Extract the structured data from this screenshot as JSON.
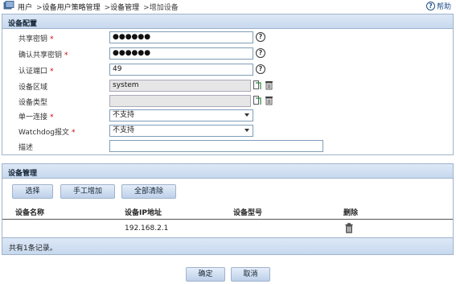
{
  "breadcrumb": {
    "items": [
      "用户",
      "设备用户策略管理",
      "设备管理",
      "增加设备"
    ],
    "separator": ">"
  },
  "help": {
    "label": "帮助"
  },
  "config_panel": {
    "title": "设备配置",
    "fields": {
      "shared_key": {
        "label": "共享密钥",
        "required": "*",
        "value": "●●●●●●"
      },
      "confirm_key": {
        "label": "确认共享密钥",
        "required": "*",
        "value": "●●●●●●"
      },
      "auth_port": {
        "label": "认证端口",
        "required": "*",
        "value": "49"
      },
      "device_zone": {
        "label": "设备区域",
        "value": "system"
      },
      "device_type": {
        "label": "设备类型",
        "value": ""
      },
      "single_connection": {
        "label": "单一连接",
        "required": "*",
        "value": "不支持"
      },
      "watchdog": {
        "label": "Watchdog报文",
        "required": "*",
        "value": "不支持"
      },
      "description": {
        "label": "描述",
        "value": ""
      }
    },
    "help_mark": "?"
  },
  "manage_panel": {
    "title": "设备管理",
    "buttons": {
      "select": "选择",
      "manual_add": "手工增加",
      "clear_all": "全部清除"
    },
    "columns": {
      "name": "设备名称",
      "ip": "设备IP地址",
      "model": "设备型号",
      "delete": "删除"
    },
    "rows": [
      {
        "name": "",
        "ip": "192.168.2.1",
        "model": ""
      }
    ],
    "summary": "共有1条记录。"
  },
  "footer": {
    "ok": "确定",
    "cancel": "取消"
  },
  "colors": {
    "panel_header": "#c7d8ee",
    "border": "#9fb3cc",
    "required": "#cc0000",
    "link": "#1f4f8a"
  }
}
